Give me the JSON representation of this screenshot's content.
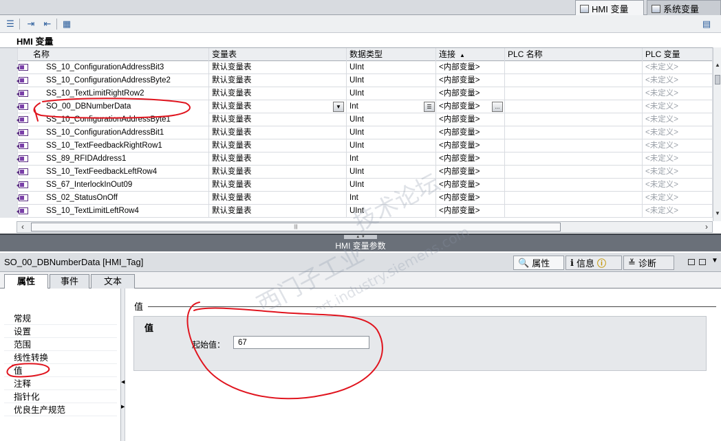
{
  "top_tabs": {
    "hmi": "HMI 变量",
    "system": "系统变量"
  },
  "table": {
    "title": "HMI 变量",
    "columns": [
      "名称",
      "变量表",
      "数据类型",
      "连接",
      "PLC 名称",
      "PLC 变量"
    ],
    "rows": [
      {
        "name": "SS_10_ConfigurationAddressBit3",
        "table": "默认变量表",
        "type": "UInt",
        "conn": "<内部变量>",
        "plc": "",
        "plcv": "<未定义>"
      },
      {
        "name": "SS_10_ConfigurationAddressByte2",
        "table": "默认变量表",
        "type": "UInt",
        "conn": "<内部变量>",
        "plc": "",
        "plcv": "<未定义>"
      },
      {
        "name": "SS_10_TextLimitRightRow2",
        "table": "默认变量表",
        "type": "UInt",
        "conn": "<内部变量>",
        "plc": "",
        "plcv": "<未定义>"
      },
      {
        "name": "SO_00_DBNumberData",
        "table": "默认变量表",
        "type": "Int",
        "conn": "<内部变量>",
        "plc": "",
        "plcv": "<未定义>"
      },
      {
        "name": "SS_10_ConfigurationAddressByte1",
        "table": "默认变量表",
        "type": "UInt",
        "conn": "<内部变量>",
        "plc": "",
        "plcv": "<未定义>"
      },
      {
        "name": "SS_10_ConfigurationAddressBit1",
        "table": "默认变量表",
        "type": "UInt",
        "conn": "<内部变量>",
        "plc": "",
        "plcv": "<未定义>"
      },
      {
        "name": "SS_10_TextFeedbackRightRow1",
        "table": "默认变量表",
        "type": "UInt",
        "conn": "<内部变量>",
        "plc": "",
        "plcv": "<未定义>"
      },
      {
        "name": "SS_89_RFIDAddress1",
        "table": "默认变量表",
        "type": "Int",
        "conn": "<内部变量>",
        "plc": "",
        "plcv": "<未定义>"
      },
      {
        "name": "SS_10_TextFeedbackLeftRow4",
        "table": "默认变量表",
        "type": "UInt",
        "conn": "<内部变量>",
        "plc": "",
        "plcv": "<未定义>"
      },
      {
        "name": "SS_67_InterlockInOut09",
        "table": "默认变量表",
        "type": "UInt",
        "conn": "<内部变量>",
        "plc": "",
        "plcv": "<未定义>"
      },
      {
        "name": "SS_02_StatusOnOff",
        "table": "默认变量表",
        "type": "Int",
        "conn": "<内部变量>",
        "plc": "",
        "plcv": "<未定义>"
      },
      {
        "name": "SS_10_TextLimitLeftRow4",
        "table": "默认变量表",
        "type": "UInt",
        "conn": "<内部变量>",
        "plc": "",
        "plcv": "<未定义>"
      }
    ]
  },
  "divider": {
    "label": "HMI 变量参数"
  },
  "inspector": {
    "title": "SO_00_DBNumberData [HMI_Tag]",
    "tabs": {
      "props": "属性",
      "info": "信息",
      "diag": "诊断"
    },
    "subtabs": {
      "attr": "属性",
      "event": "事件",
      "text": "文本"
    },
    "nav": [
      "常规",
      "设置",
      "范围",
      "线性转换",
      "值",
      "注释",
      "指针化",
      "优良生产规范"
    ],
    "section_title": "值",
    "group_title": "值",
    "start_label": "起始值：",
    "start_value": "67"
  },
  "watermark": {
    "line1": "西门子工业",
    "line2": "技术论坛",
    "line3": "support.industry.siemens.com"
  },
  "colors": {
    "annotation": "#e0141e",
    "divider": "#6a7079",
    "tag_icon": "#5a2d82"
  }
}
